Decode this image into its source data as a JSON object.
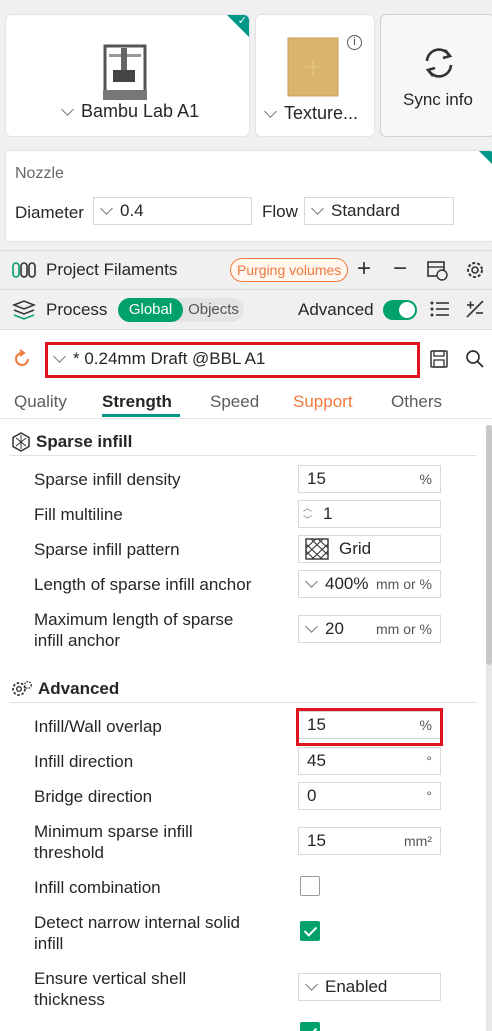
{
  "printer": {
    "name": "Bambu Lab A1"
  },
  "plate": {
    "name": "Texture..."
  },
  "sync": {
    "label": "Sync info"
  },
  "nozzle": {
    "title": "Nozzle",
    "diameter_label": "Diameter",
    "diameter_value": "0.4",
    "flow_label": "Flow",
    "flow_value": "Standard"
  },
  "filaments": {
    "title": "Project Filaments",
    "purging_label": "Purging volumes"
  },
  "process": {
    "title": "Process",
    "global_label": "Global",
    "objects_label": "Objects",
    "advanced_label": "Advanced",
    "advanced_on": true
  },
  "preset": {
    "name": "* 0.24mm Draft @BBL A1"
  },
  "tabs": [
    {
      "label": "Quality"
    },
    {
      "label": "Strength"
    },
    {
      "label": "Speed"
    },
    {
      "label": "Support"
    },
    {
      "label": "Others"
    }
  ],
  "active_tab": "Strength",
  "sparse": {
    "title": "Sparse infill",
    "density_label": "Sparse infill density",
    "density_value": "15",
    "density_unit": "%",
    "multiline_label": "Fill multiline",
    "multiline_value": "1",
    "pattern_label": "Sparse infill pattern",
    "pattern_value": "Grid",
    "anchor_label": "Length of sparse infill anchor",
    "anchor_value": "400%",
    "anchor_unit": "mm or %",
    "max_anchor_label_1": "Maximum length of sparse",
    "max_anchor_label_2": "infill anchor",
    "max_anchor_value": "20",
    "max_anchor_unit": "mm or %"
  },
  "advanced": {
    "title": "Advanced",
    "overlap_label": "Infill/Wall overlap",
    "overlap_value": "15",
    "overlap_unit": "%",
    "direction_label": "Infill direction",
    "direction_value": "45",
    "direction_unit": "°",
    "bridge_label": "Bridge direction",
    "bridge_value": "0",
    "bridge_unit": "°",
    "min_threshold_label_1": "Minimum sparse infill",
    "min_threshold_label_2": "threshold",
    "min_threshold_value": "15",
    "min_threshold_unit": "mm²",
    "combination_label": "Infill combination",
    "combination_checked": false,
    "narrow_label_1": "Detect narrow internal solid",
    "narrow_label_2": "infill",
    "narrow_checked": true,
    "vertical_label_1": "Ensure vertical shell",
    "vertical_label_2": "thickness",
    "vertical_value": "Enabled"
  },
  "colors": {
    "accent": "#00a16b",
    "support": "#f07a3c",
    "highlight": "#e0141e"
  }
}
